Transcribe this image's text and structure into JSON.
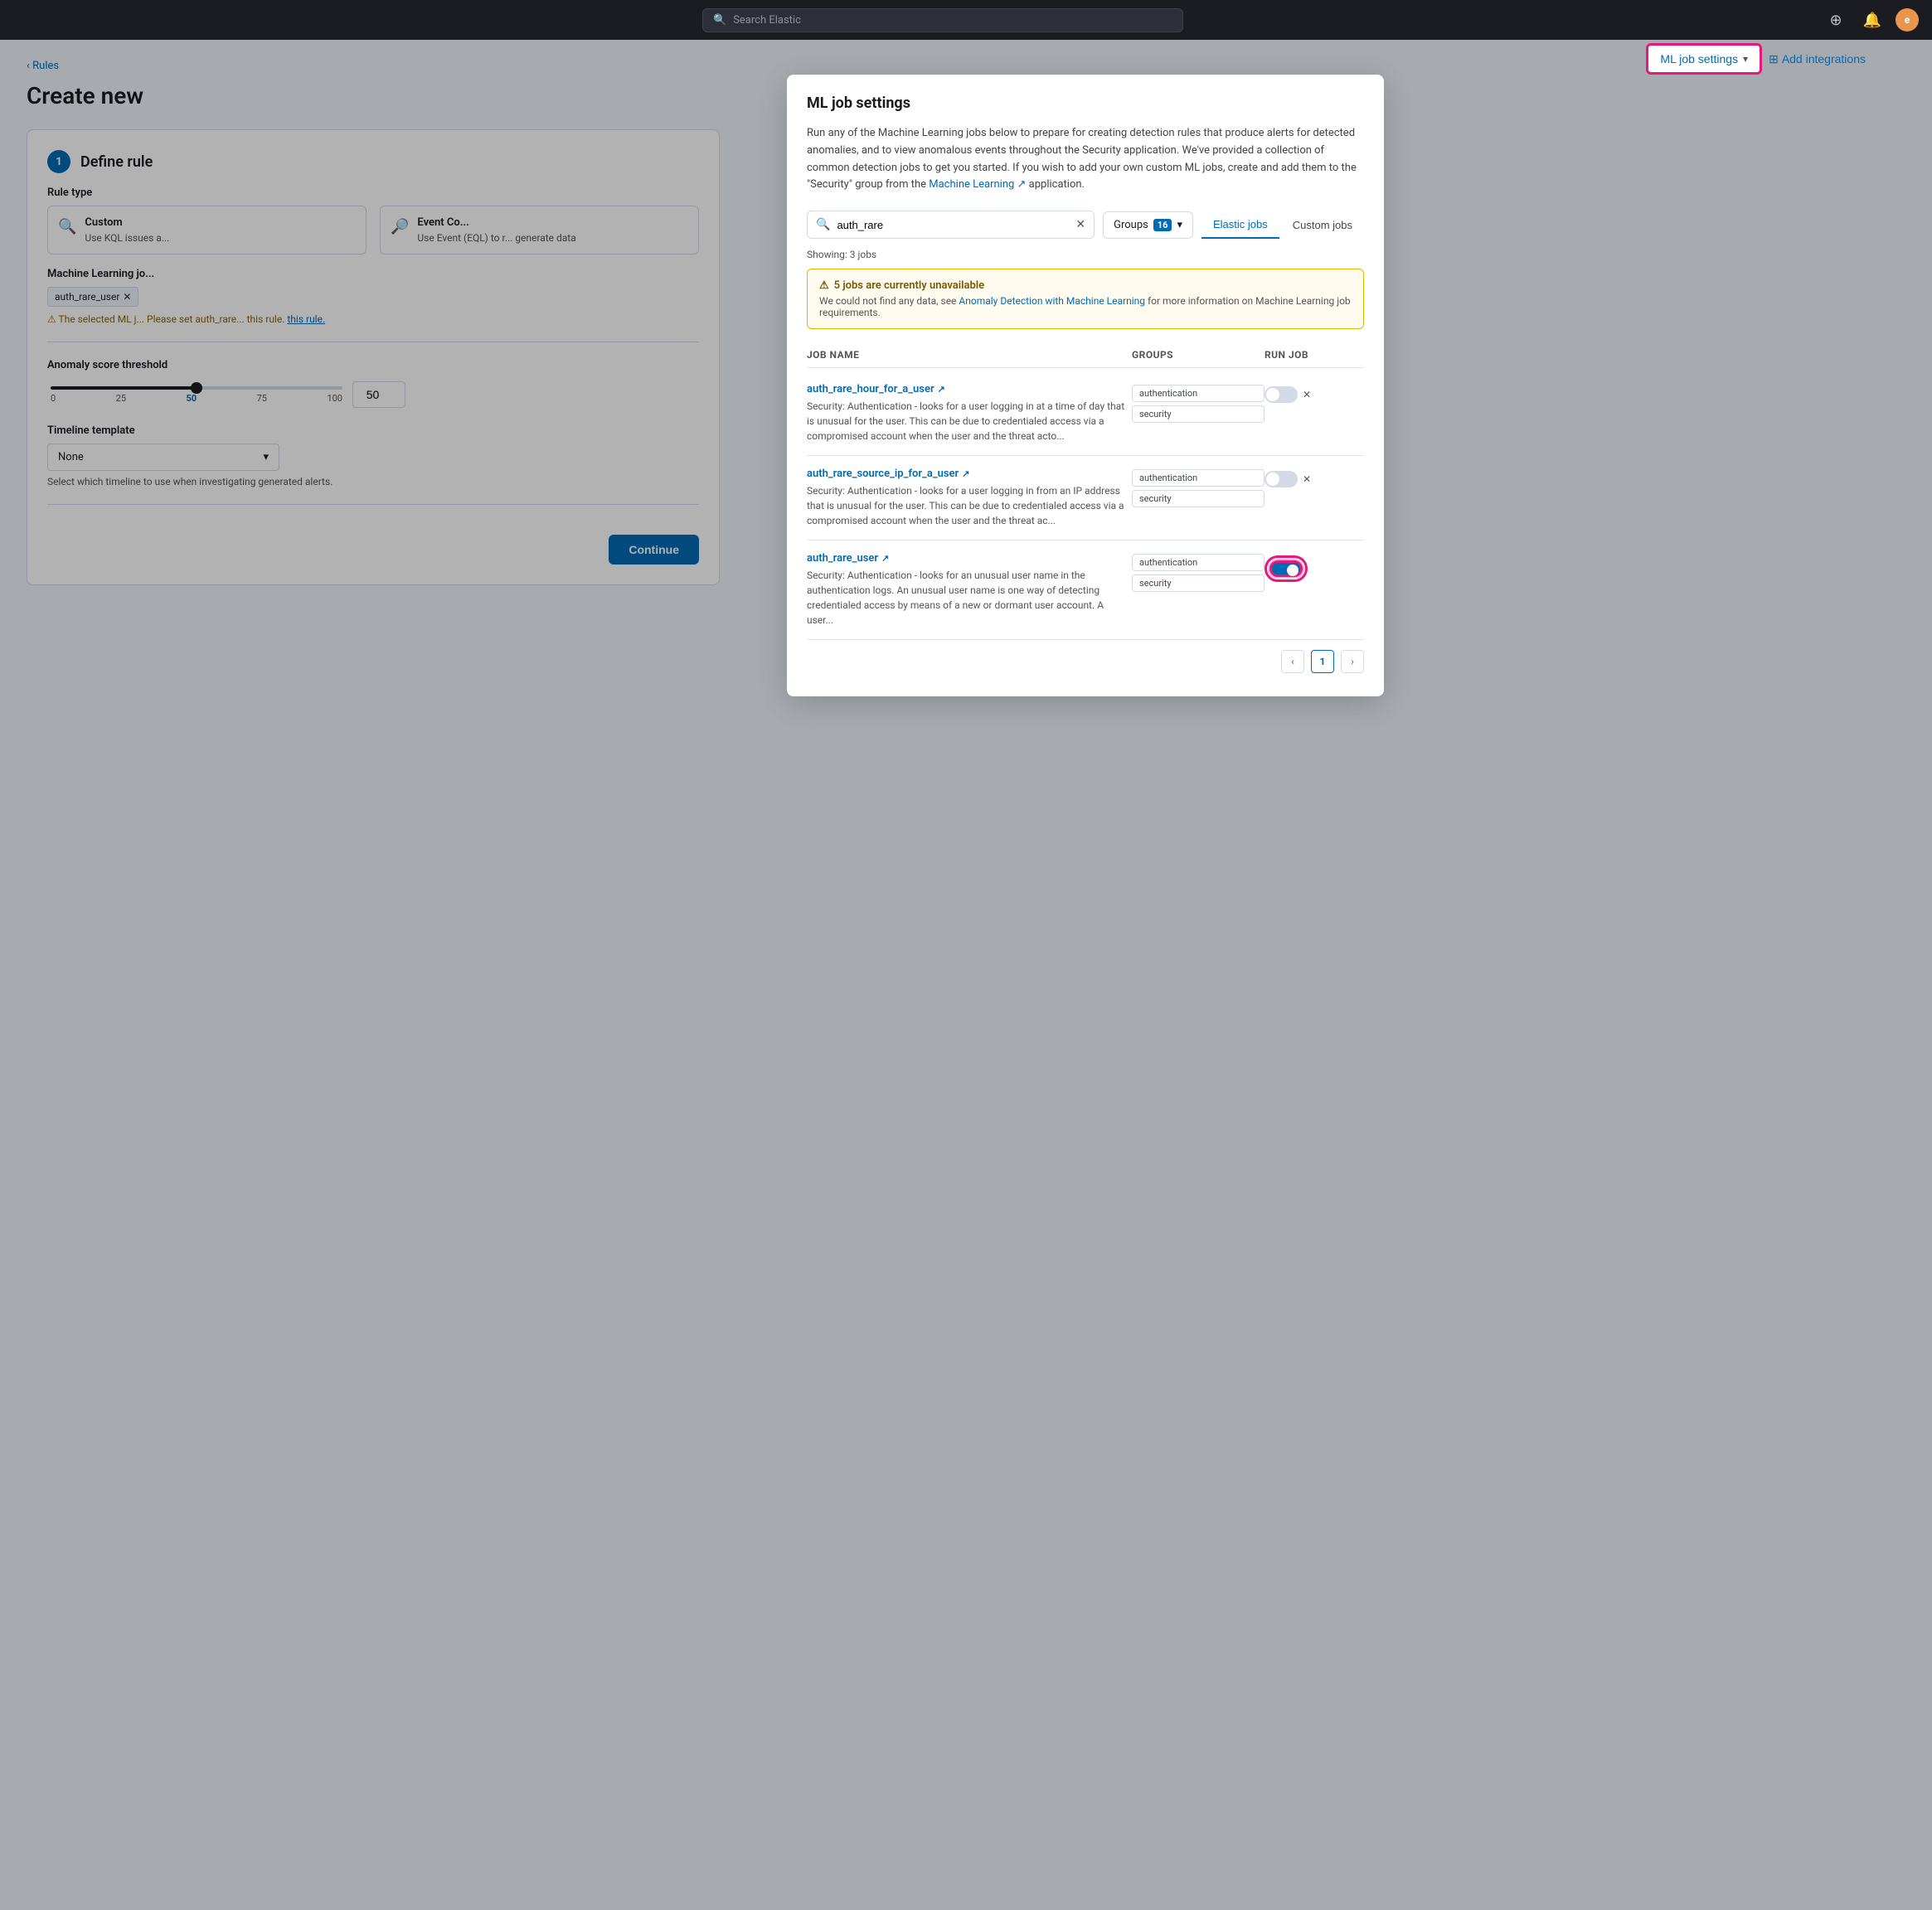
{
  "nav": {
    "search_placeholder": "Search Elastic",
    "avatar_letter": "e"
  },
  "ml_btn": {
    "label": "ML job settings",
    "add_integrations": "Add integrations"
  },
  "page": {
    "breadcrumb": "Rules",
    "title": "Create new",
    "step_number": "1",
    "step_title": "Define rule"
  },
  "rule_types": [
    {
      "id": "custom",
      "title": "Custom",
      "desc": "Use KQL issues a..."
    },
    {
      "id": "event_correlator",
      "title": "Event Co...",
      "desc": "Use Event (EQL) to r... generate data"
    }
  ],
  "ml_jobs_section": {
    "label": "Machine Learning jo...",
    "chip": "auth_rare_user",
    "warning": "⚠ The selected ML j... Please set auth_rare... this rule."
  },
  "threshold": {
    "label": "Anomaly score threshold",
    "value": "50",
    "min": "0",
    "tick1": "25",
    "tick2": "50",
    "tick3": "75",
    "max": "100",
    "percent": 50
  },
  "timeline": {
    "label": "Timeline template",
    "value": "None",
    "hint": "Select which timeline to use when investigating generated alerts."
  },
  "continue_btn": "Continue",
  "modal": {
    "title": "ML job settings",
    "desc": "Run any of the Machine Learning jobs below to prepare for creating detection rules that produce alerts for detected anomalies, and to view anomalous events throughout the Security application. We've provided a collection of common detection jobs to get you started. If you wish to add your own custom ML jobs, create and add them to the \"Security\" group from the",
    "desc_link": "Machine Learning",
    "desc_end": "application.",
    "search_value": "auth_rare",
    "groups_label": "Groups",
    "groups_count": "16",
    "elastic_jobs": "Elastic jobs",
    "custom_jobs": "Custom jobs",
    "showing": "Showing: 3 jobs",
    "warning_title": "5 jobs are currently unavailable",
    "warning_desc": "We could not find any data, see",
    "warning_link": "Anomaly Detection with Machine Learning",
    "warning_end": "for more information on Machine Learning job requirements.",
    "table": {
      "col1": "Job name",
      "col2": "Groups",
      "col3": "Run job"
    },
    "jobs": [
      {
        "id": "job1",
        "name": "auth_rare_hour_for_a_user",
        "desc": "Security: Authentication - looks for a user logging in at a time of day that is unusual for the user. This can be due to credentialed access via a compromised account when the user and the threat acto...",
        "tags": [
          "authentication",
          "security"
        ],
        "toggled": false
      },
      {
        "id": "job2",
        "name": "auth_rare_source_ip_for_a_user",
        "desc": "Security: Authentication - looks for a user logging in from an IP address that is unusual for the user. This can be due to credentialed access via a compromised account when the user and the threat ac...",
        "tags": [
          "authentication",
          "security"
        ],
        "toggled": false
      },
      {
        "id": "job3",
        "name": "auth_rare_user",
        "desc": "Security: Authentication - looks for an unusual user name in the authentication logs. An unusual user name is one way of detecting credentialed access by means of a new or dormant user account. A user...",
        "tags": [
          "authentication",
          "security"
        ],
        "toggled": true
      }
    ],
    "page_num": "1"
  }
}
